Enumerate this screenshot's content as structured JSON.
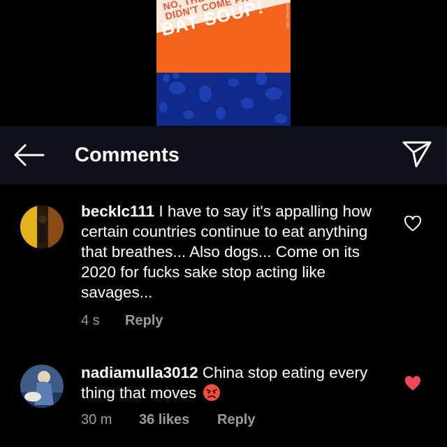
{
  "post": {
    "headline_top": "NO, THE\nDIDN'T COME FR",
    "headline_main": "BAT SOUP!",
    "side_text": "www.cnet.com",
    "colors": {
      "orange": "#f2641d",
      "blue": "#0f2a8a",
      "band": "#fbe8d9"
    }
  },
  "header": {
    "title": "Comments",
    "back_icon": "arrow-left-icon",
    "send_icon": "paper-plane-icon",
    "background": "#0c1017"
  },
  "comments": [
    {
      "username": "becklc111",
      "text": "I have to say it's appalling how certain countries continue to eat anything that breathes... Also dogs... Come on its 2020 for fucks sake stop acting like savages...",
      "time": "4 s",
      "reply_label": "Reply",
      "liked": false,
      "heart_icon": "heart-outline-icon"
    },
    {
      "username": "nadiamulla3012",
      "text": "China stop eating every thing that moves",
      "emoji": "angry-face-emoji",
      "time": "30 m",
      "likes_label": "36 likes",
      "reply_label": "Reply",
      "liked": true,
      "heart_icon": "heart-filled-icon",
      "heart_color": "#ed4956"
    }
  ]
}
